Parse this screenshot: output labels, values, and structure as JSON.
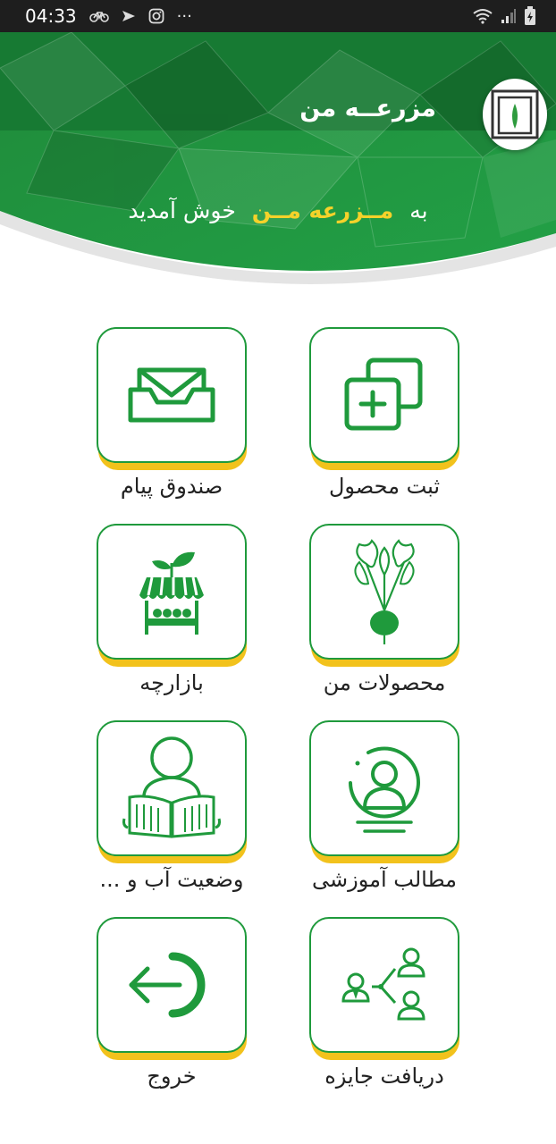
{
  "status_bar": {
    "time": "04:33",
    "dots": "···"
  },
  "header": {
    "title": "مزرعــه من",
    "welcome_prefix": "به",
    "welcome_highlight": "مــزرعه مــن",
    "welcome_suffix": "خوش آمدید"
  },
  "colors": {
    "primary_green": "#1f9a3c",
    "accent_yellow": "#f2c21c",
    "highlight_text": "#f5d22a"
  },
  "menu": {
    "register_product": {
      "label": "ثبت محصول",
      "icon": "add-copy-icon"
    },
    "inbox": {
      "label": "صندوق پیام",
      "icon": "mail-inbox-icon"
    },
    "my_products": {
      "label": "محصولات من",
      "icon": "beet-icon"
    },
    "market": {
      "label": "بازارچه",
      "icon": "market-stall-icon"
    },
    "education": {
      "label": "مطالب آموزشی",
      "icon": "person-badge-icon"
    },
    "water_status": {
      "label": "وضعیت آب و ...",
      "icon": "reading-person-icon"
    },
    "get_reward": {
      "label": "دریافت جایزه",
      "icon": "share-people-icon"
    },
    "exit": {
      "label": "خروج",
      "icon": "logout-arrow-icon"
    }
  }
}
